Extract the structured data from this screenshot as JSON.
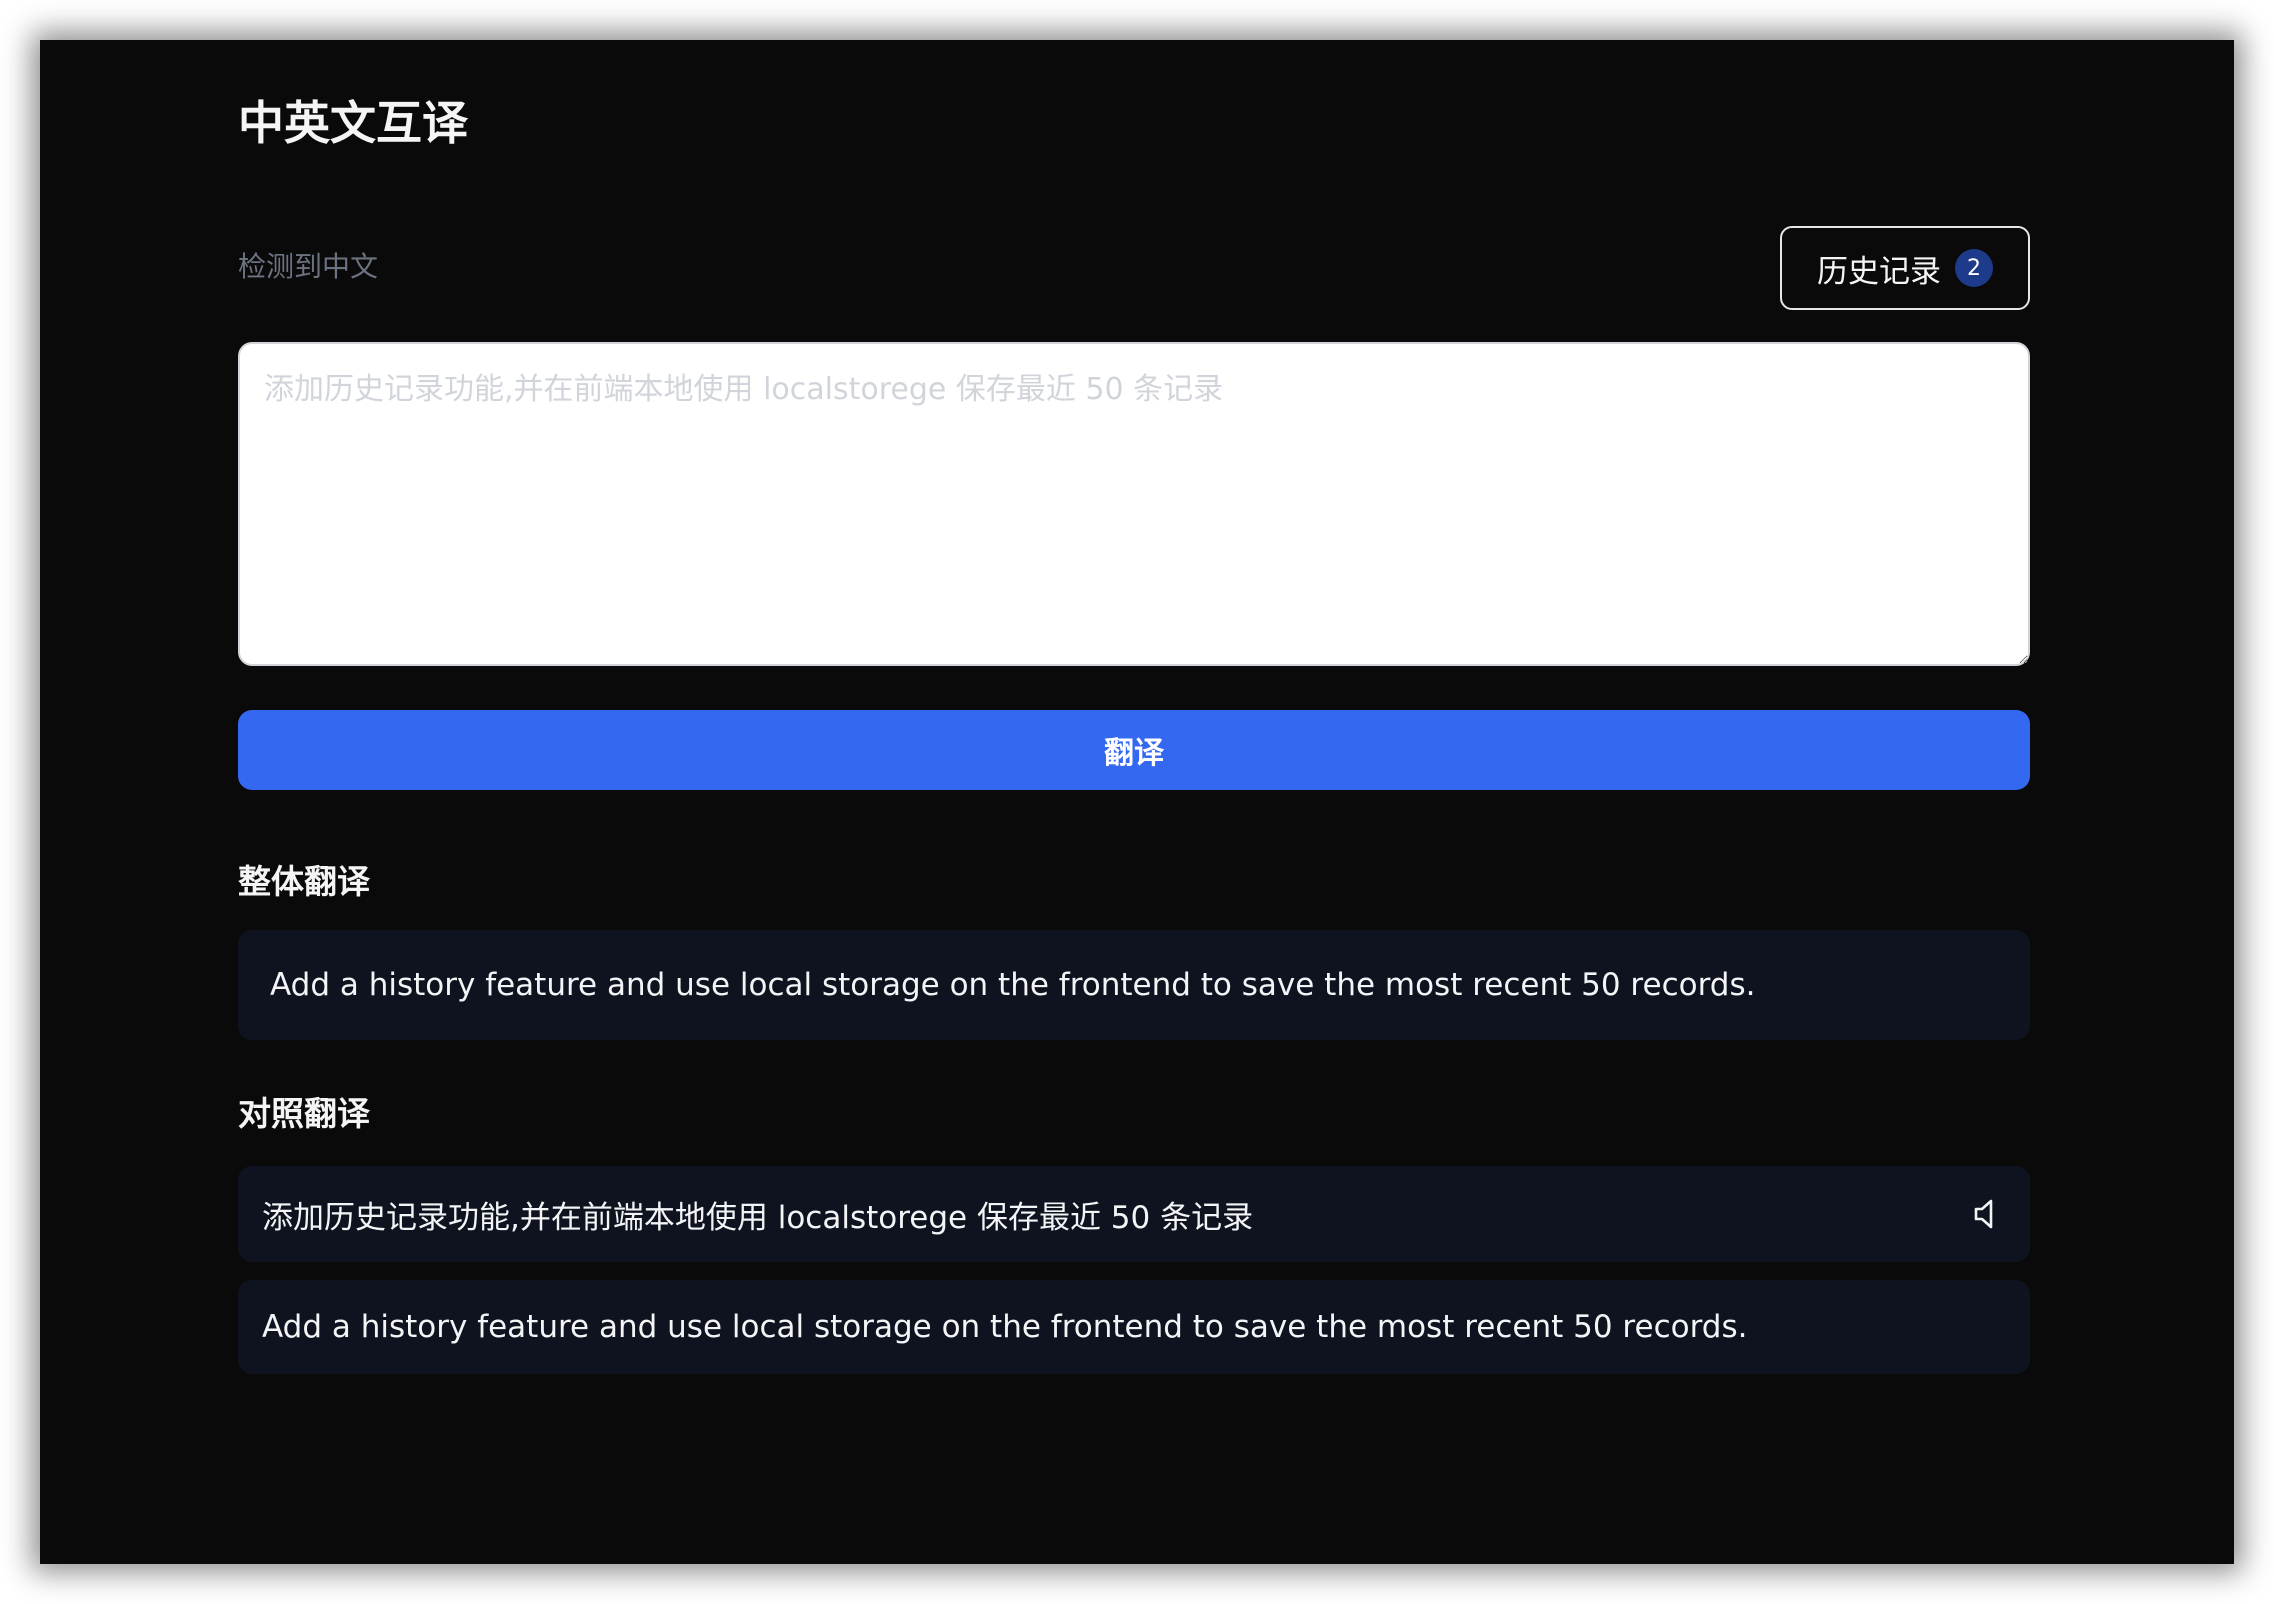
{
  "app": {
    "title": "中英文互译"
  },
  "detection": {
    "label": "检测到中文"
  },
  "history": {
    "label": "历史记录",
    "count": "2"
  },
  "input": {
    "value": "",
    "placeholder": "添加历史记录功能,并在前端本地使用 localstorege 保存最近 50 条记录"
  },
  "translate_button": {
    "label": "翻译"
  },
  "overall": {
    "heading": "整体翻译",
    "text": "Add a history feature and use local storage on the frontend to save the most recent 50 records."
  },
  "comparison": {
    "heading": "对照翻译",
    "rows": [
      {
        "text": "添加历史记录功能,并在前端本地使用 localstorege 保存最近 50 条记录",
        "icon": "speaker-icon"
      },
      {
        "text": "Add a history feature and use local storage on the frontend to save the most recent 50 records."
      }
    ]
  },
  "colors": {
    "background": "#0a0a0a",
    "accent": "#3468f0",
    "panel": "#0f1320",
    "badge": "#1e3a8a"
  }
}
